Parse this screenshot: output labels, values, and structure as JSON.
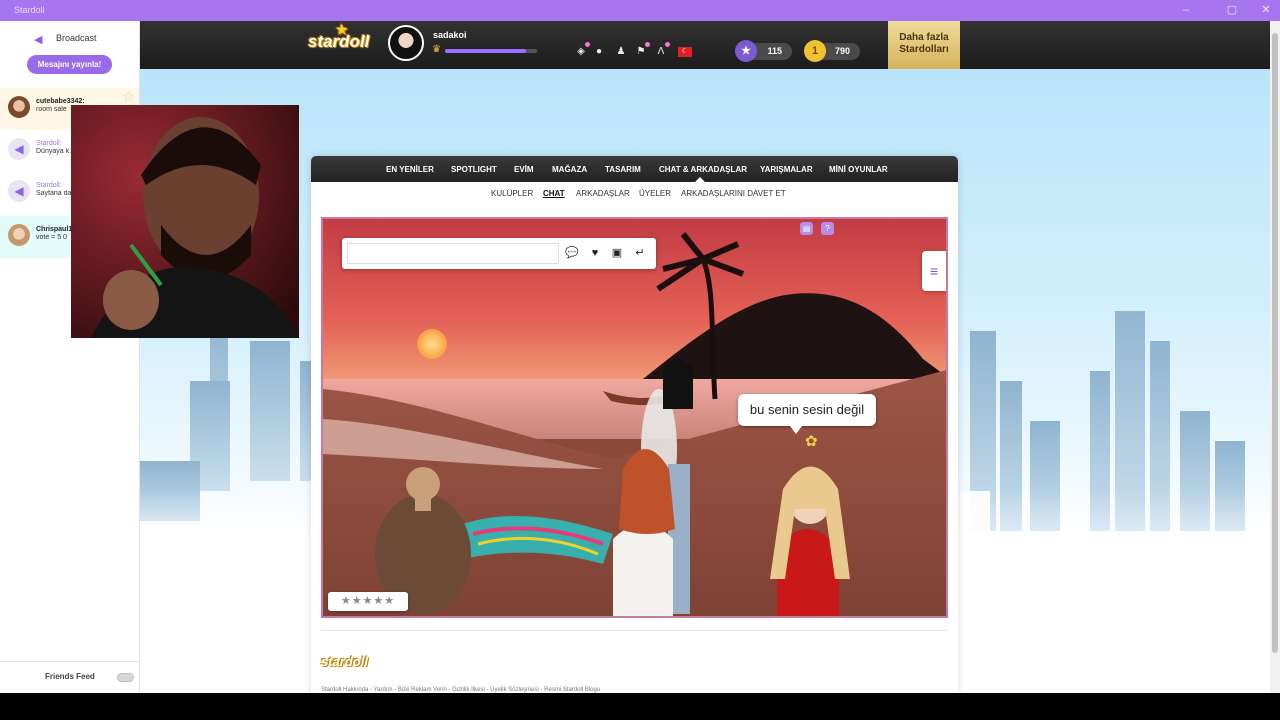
{
  "window": {
    "title": "Stardoll"
  },
  "sidebar": {
    "broadcast_label": "Broadcast",
    "publish_button": "Mesajını yayınla!",
    "feed": [
      {
        "name": "cutebabe3342:",
        "text": "room sale",
        "type": "user"
      },
      {
        "name": "Stardoll:",
        "text": "Dünyaya k... mesajını bi...",
        "type": "stardoll"
      },
      {
        "name": "Stardoll:",
        "text": "Sayfana da... çek. Yayını...",
        "type": "stardoll"
      },
      {
        "name": "Chrispaul1",
        "text": "vote = 5 0",
        "type": "user"
      }
    ],
    "friends_feed": "Friends Feed"
  },
  "header": {
    "logo": "stardoll",
    "username": "sadakoi",
    "level_progress": 0.88,
    "stardollars_promo": "Daha fazla Stardolları",
    "stars": "115",
    "coins": "790",
    "icons": [
      "closet-icon",
      "chat-bubbles-icon",
      "friends-icon",
      "bookmark-icon",
      "fashion-icon",
      "flag-tr-icon"
    ]
  },
  "nav": {
    "items": [
      "EN YENİLER",
      "SPOTLIGHT",
      "EVİM",
      "MAĞAZA",
      "TASARIM",
      "CHAT & ARKADAŞLAR",
      "YARIŞMALAR",
      "MİNİ OYUNLAR"
    ],
    "sub": [
      "KULÜPLER",
      "CHAT",
      "ARKADAŞLAR",
      "ÜYELER",
      "ARKADAŞLARINI DAVET ET"
    ],
    "active_sub": "CHAT"
  },
  "scene": {
    "chat_placeholder": "",
    "speech_bubble": "bu senin sesin değil",
    "rating_stars": "★★★★★"
  },
  "footer": {
    "logo": "stardoll",
    "links": "Stardoll Hakkında - Yardım - Bize Reklam Verin - Gizlilik İlkesi - Üyelik Sözleşmesi - Resmi Stardoll Blogu"
  },
  "colors": {
    "accent": "#9a6ae8",
    "titlebar": "#a875f0",
    "promo": "#e3c777"
  }
}
